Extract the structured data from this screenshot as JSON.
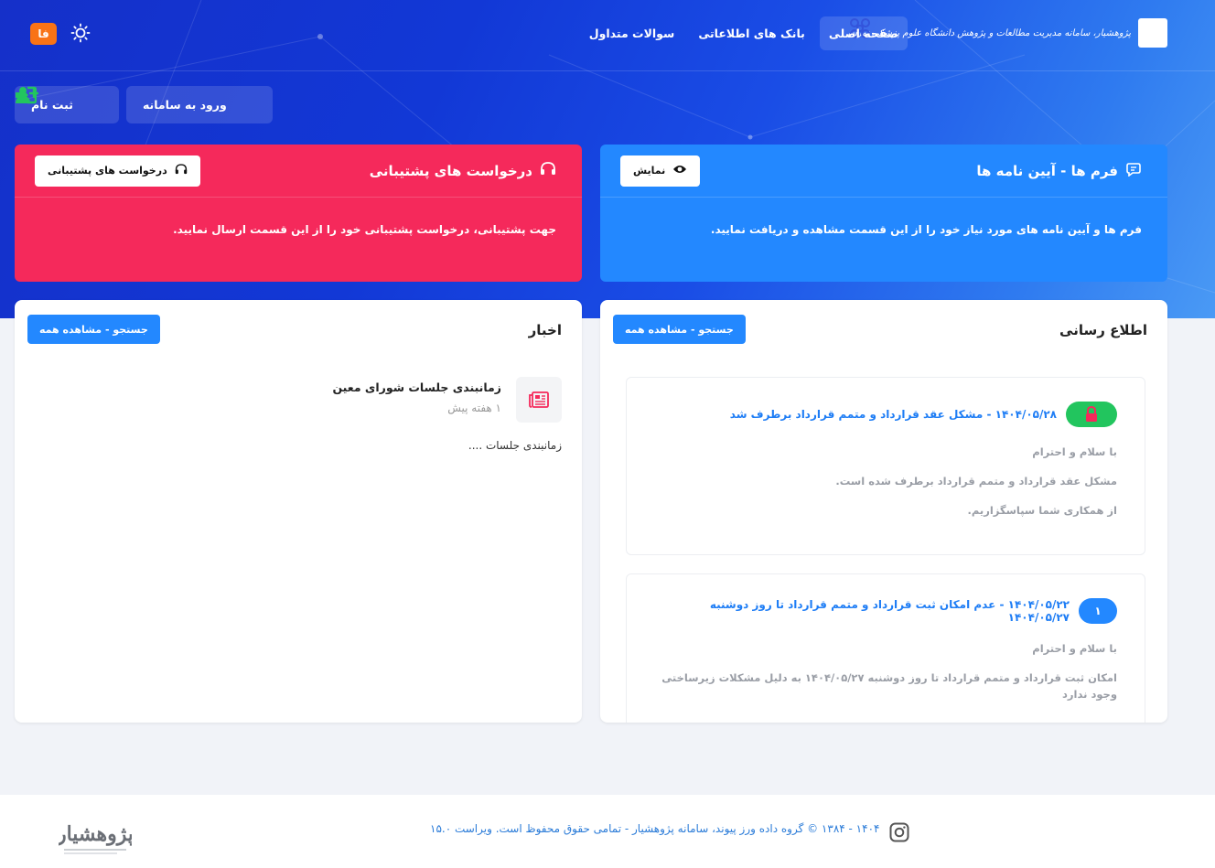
{
  "header": {
    "brand_text": "پژوهشیار، سامانه مدیریت مطالعات و پژوهش دانشگاه علوم پزشکی تهران",
    "nav": [
      {
        "label": "صفحه اصلی",
        "active": true
      },
      {
        "label": "بانک های اطلاعاتی",
        "active": false
      },
      {
        "label": "سوالات متداول",
        "active": false
      }
    ],
    "lang_label": "فا"
  },
  "auth": {
    "login_label": "ورود به سامانه",
    "register_label": "ثبت نام"
  },
  "forms_card": {
    "title": "فرم ها - آیین نامه ها",
    "button_label": "نمایش",
    "body": "فرم ها و آیین نامه های مورد نیاز خود را از این قسمت مشاهده و دریافت نمایید.",
    "color": "#2388ff"
  },
  "support_card": {
    "title": "درخواست های پشتیبانی",
    "button_label": "درخواست های پشتیبانی",
    "body": "جهت پشتیبانی، درخواست پشتیبانی خود را از این قسمت ارسال نمایید.",
    "color": "#f5295b"
  },
  "announcements": {
    "title": "اطلاع رسانی",
    "button_label": "جستجو - مشاهده همه",
    "items": [
      {
        "badge_icon": "lock-icon",
        "title": "۱۴۰۴/۰۵/۲۸ - مشکل عقد قرارداد و متمم قرارداد برطرف شد",
        "lines": [
          "با سلام و احترام",
          "مشکل عقد قرارداد و متمم قرارداد برطرف شده است.",
          "از همکاری شما سپاسگزاریم."
        ]
      },
      {
        "badge_text": "۱",
        "title": "۱۴۰۴/۰۵/۲۲ - عدم امکان ثبت قرارداد و متمم قرارداد تا روز دوشنبه ۱۴۰۴/۰۵/۲۷",
        "lines": [
          "با سلام و احترام",
          "امکان ثبت قرارداد و متمم قرارداد تا روز دوشنبه ۱۴۰۴/۰۵/۲۷ به دلیل مشکلات زیرساختی وجود ندارد"
        ]
      }
    ]
  },
  "news": {
    "title": "اخبار",
    "button_label": "جستجو - مشاهده همه",
    "items": [
      {
        "title": "زمانبندی جلسات شورای معین",
        "time": "۱ هفته پیش",
        "desc": "زمانبندی جلسات ...."
      }
    ]
  },
  "footer": {
    "copyright": "۱۴۰۴ - ۱۳۸۴ © گروه داده ورز پیوند، سامانه پژوهشیار - تمامی حقوق محفوظ است. ویراست ۱۵.۰",
    "logo_text": "پژوهشیار"
  }
}
